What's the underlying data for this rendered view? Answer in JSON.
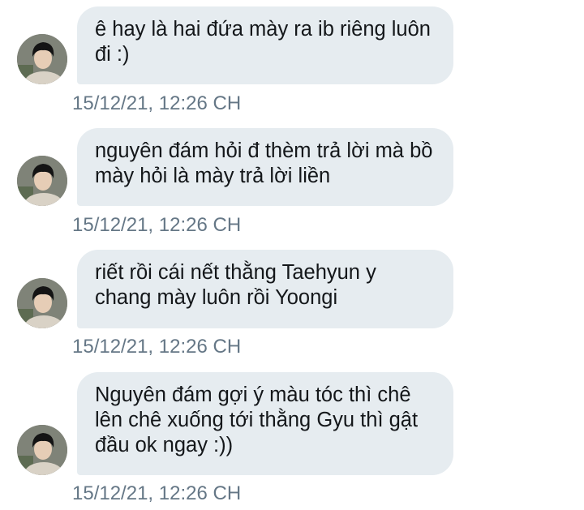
{
  "messages": [
    {
      "text": "ê hay là hai đứa mày ra ib riêng luôn đi :)",
      "timestamp": "15/12/21, 12:26 CH"
    },
    {
      "text": "nguyên đám hỏi đ thèm trả lời mà bồ mày hỏi là mày trả lời liền",
      "timestamp": "15/12/21, 12:26 CH"
    },
    {
      "text": "riết rồi cái nết thằng Taehyun y chang mày luôn rồi Yoongi",
      "timestamp": "15/12/21, 12:26 CH"
    },
    {
      "text": "Nguyên đám gợi ý màu tóc thì chê lên chê xuống tới thằng Gyu thì gật đầu ok ngay :))",
      "timestamp": "15/12/21, 12:26 CH"
    }
  ],
  "colors": {
    "bubble_background": "#e6ecf0",
    "message_text": "#14171a",
    "timestamp_text": "#657786"
  }
}
